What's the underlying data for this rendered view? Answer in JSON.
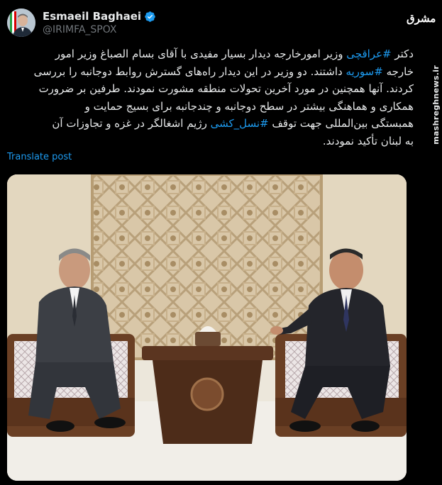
{
  "account": {
    "display_name": "Esmaeil Baghaei",
    "handle": "@IRIMFA_SPOX",
    "verified_icon": "verified-badge-icon",
    "verified_color": "#1d9bf0"
  },
  "post": {
    "lines": [
      {
        "pre": "دکتر ",
        "tag": "#عراقچی",
        "post": " وزیر امورخارجه دیدار بسیار مفیدی با آقای بسام الصباغ وزیر امور"
      },
      {
        "pre": "خارجه ",
        "tag": "#سوریه",
        "post": " داشتند. دو وزیر در این دیدار راه‌های گسترش روابط دوجانبه را بررسی"
      },
      {
        "pre": "کردند. آنها همچنین در مورد آخرین تحولات منطقه مشورت نمودند. طرفین بر ضرورت",
        "tag": "",
        "post": ""
      },
      {
        "pre": "همکاری و هماهنگی بیشتر در سطح دوجانبه و چندجانبه برای بسیج حمایت و",
        "tag": "",
        "post": ""
      },
      {
        "pre": "همبستگی بین‌المللی جهت توقف ",
        "tag": "#نسل_کشی",
        "post": " رژیم اشغالگر در غزه و تجاوزات آن"
      },
      {
        "pre": "به لبنان تأکید نمودند.",
        "tag": "",
        "post": ""
      }
    ],
    "translate_label": "Translate post",
    "link_color": "#1d9bf0"
  },
  "watermark": {
    "logo_text": "مشرق",
    "url": "mashreghnews.ir"
  },
  "photo": {
    "subject": "meeting-photo"
  }
}
